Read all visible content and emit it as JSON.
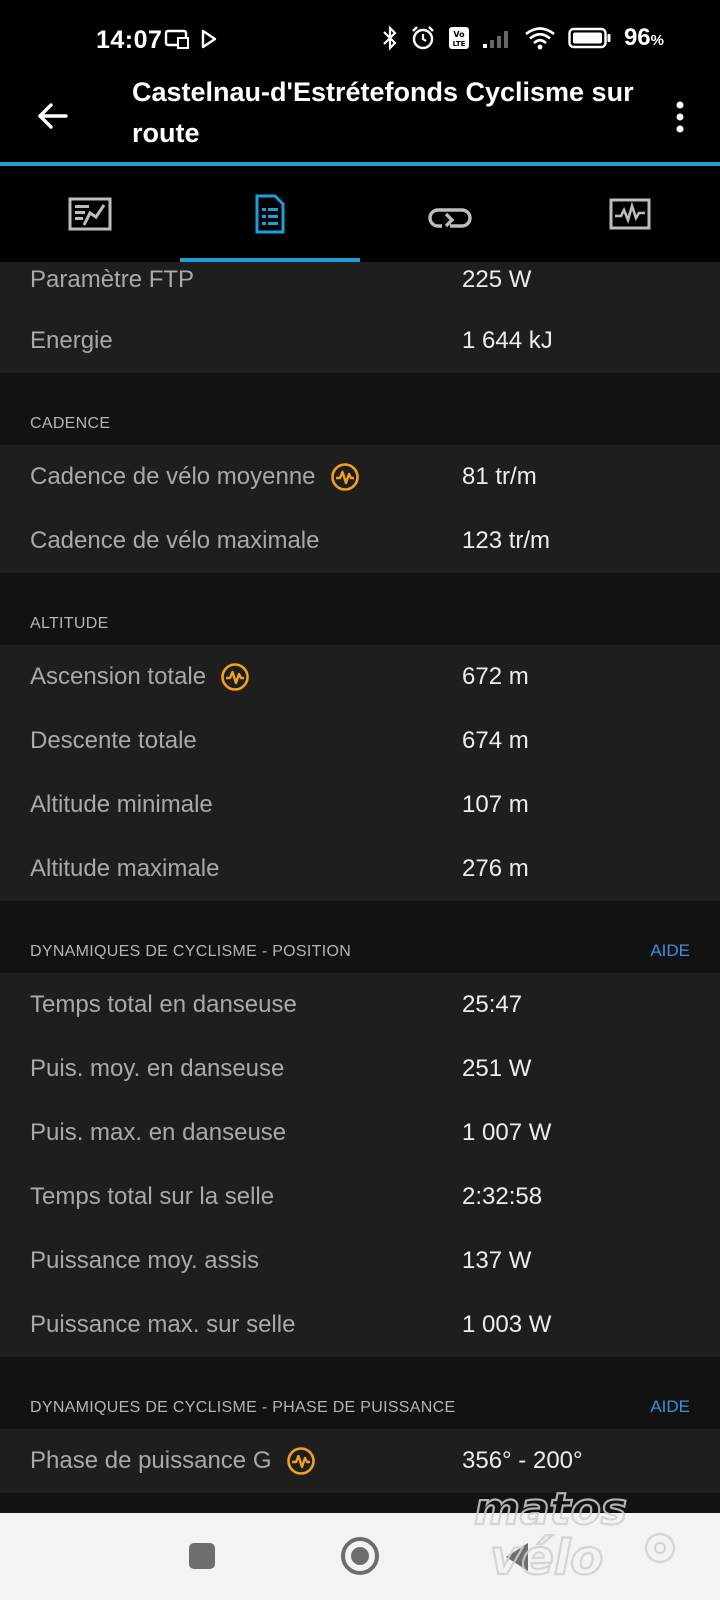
{
  "status_bar": {
    "time": "14:07",
    "battery": "96",
    "battery_unit": "%",
    "icons": [
      "cast-icon",
      "play-store-icon",
      "bluetooth-icon",
      "alarm-icon",
      "volte-icon",
      "signal-icon",
      "wifi-icon",
      "battery-icon"
    ]
  },
  "header": {
    "title": "Castelnau-d'Estrétefonds Cyclisme sur route"
  },
  "tabs": [
    {
      "icon": "overview-chart-icon",
      "active": false
    },
    {
      "icon": "stats-list-icon",
      "active": true
    },
    {
      "icon": "laps-icon",
      "active": false
    },
    {
      "icon": "graphs-icon",
      "active": false
    }
  ],
  "power_rows": [
    {
      "label": "Paramètre FTP",
      "value": "225 W"
    },
    {
      "label": "Energie",
      "value": "1 644 kJ"
    }
  ],
  "cadence": {
    "title": "CADENCE",
    "rows": [
      {
        "label": "Cadence de vélo moyenne",
        "value": "81 tr/m",
        "icon": "power-meter-icon"
      },
      {
        "label": "Cadence de vélo maximale",
        "value": "123 tr/m"
      }
    ]
  },
  "altitude": {
    "title": "ALTITUDE",
    "rows": [
      {
        "label": "Ascension totale",
        "value": "672 m",
        "icon": "power-meter-icon"
      },
      {
        "label": "Descente totale",
        "value": "674 m"
      },
      {
        "label": "Altitude minimale",
        "value": "107 m"
      },
      {
        "label": "Altitude maximale",
        "value": "276 m"
      }
    ]
  },
  "dynamics_position": {
    "title": "DYNAMIQUES DE CYCLISME - POSITION",
    "help": "AIDE",
    "rows": [
      {
        "label": "Temps total en danseuse",
        "value": "25:47"
      },
      {
        "label": "Puis. moy. en danseuse",
        "value": "251 W"
      },
      {
        "label": "Puis. max. en danseuse",
        "value": "1 007 W"
      },
      {
        "label": "Temps total sur la selle",
        "value": "2:32:58"
      },
      {
        "label": "Puissance moy. assis",
        "value": "137 W"
      },
      {
        "label": "Puissance max. sur selle",
        "value": "1 003 W"
      }
    ]
  },
  "dynamics_phase": {
    "title": "DYNAMIQUES DE CYCLISME - PHASE DE PUISSANCE",
    "help": "AIDE",
    "rows": [
      {
        "label": "Phase de puissance G",
        "value": "356° - 200°",
        "icon": "power-meter-icon"
      }
    ]
  },
  "watermark": "matos vélo",
  "colors": {
    "accent": "#1e9fd8",
    "help_link": "#3d8fdc",
    "icon_orange": "#f0a020",
    "row_bg": "#1e1e1e",
    "section_bg": "#121212"
  }
}
